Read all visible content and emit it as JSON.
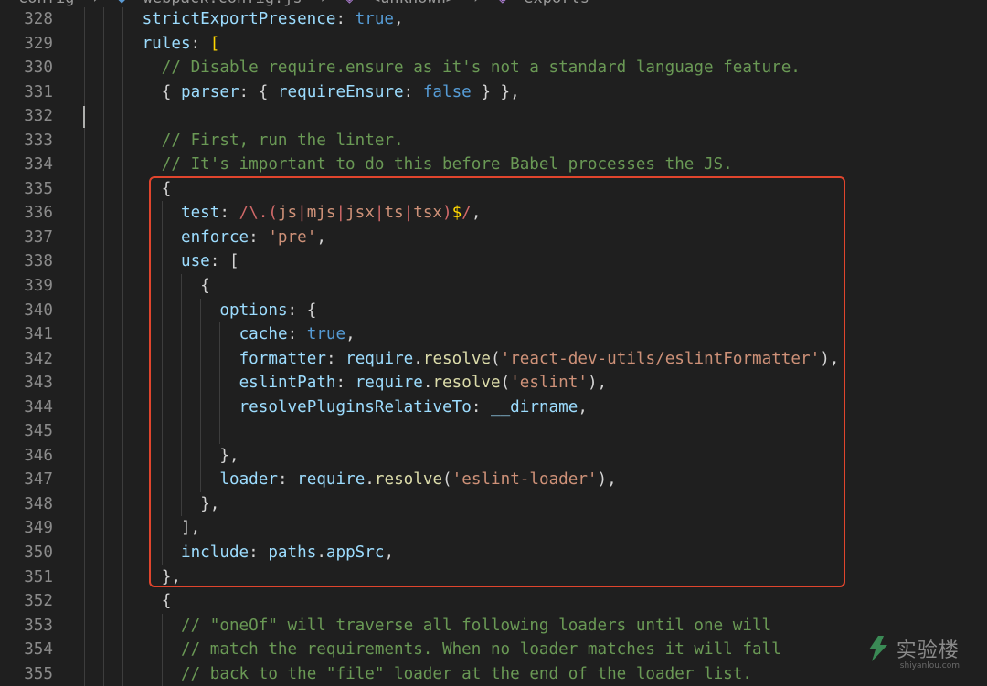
{
  "breadcrumb": {
    "items": [
      "config",
      "webpack.config.js",
      "<unknown>",
      "exports"
    ]
  },
  "editor": {
    "lines": [
      {
        "n": "328",
        "indent": 3,
        "tokens": [
          [
            "p",
            "strictExportPresence"
          ],
          [
            "w",
            ": "
          ],
          [
            "k",
            "true"
          ],
          [
            "w",
            ","
          ]
        ]
      },
      {
        "n": "329",
        "indent": 3,
        "tokens": [
          [
            "p",
            "rules"
          ],
          [
            "w",
            ": "
          ],
          [
            "y",
            "["
          ]
        ]
      },
      {
        "n": "330",
        "indent": 4,
        "tokens": [
          [
            "c",
            "// Disable require.ensure as it's not a standard language feature."
          ]
        ]
      },
      {
        "n": "331",
        "indent": 4,
        "tokens": [
          [
            "w",
            "{ "
          ],
          [
            "p",
            "parser"
          ],
          [
            "w",
            ": { "
          ],
          [
            "p",
            "requireEnsure"
          ],
          [
            "w",
            ": "
          ],
          [
            "k",
            "false"
          ],
          [
            "w",
            " } },"
          ]
        ]
      },
      {
        "n": "332",
        "indent": 0,
        "tokens": []
      },
      {
        "n": "333",
        "indent": 4,
        "tokens": [
          [
            "c",
            "// First, run the linter."
          ]
        ]
      },
      {
        "n": "334",
        "indent": 4,
        "tokens": [
          [
            "c",
            "// It's important to do this before Babel processes the JS."
          ]
        ]
      },
      {
        "n": "335",
        "indent": 4,
        "tokens": [
          [
            "w",
            "{"
          ]
        ]
      },
      {
        "n": "336",
        "indent": 5,
        "tokens": [
          [
            "p",
            "test"
          ],
          [
            "w",
            ": "
          ],
          [
            "r",
            "/\\.("
          ],
          [
            "s",
            "js"
          ],
          [
            "r",
            "|"
          ],
          [
            "s",
            "mjs"
          ],
          [
            "r",
            "|"
          ],
          [
            "s",
            "jsx"
          ],
          [
            "r",
            "|"
          ],
          [
            "s",
            "ts"
          ],
          [
            "r",
            "|"
          ],
          [
            "s",
            "tsx"
          ],
          [
            "r",
            ")"
          ],
          [
            "y",
            "$"
          ],
          [
            "r",
            "/"
          ],
          [
            "w",
            ","
          ]
        ]
      },
      {
        "n": "337",
        "indent": 5,
        "tokens": [
          [
            "p",
            "enforce"
          ],
          [
            "w",
            ": "
          ],
          [
            "s",
            "'pre'"
          ],
          [
            "w",
            ","
          ]
        ]
      },
      {
        "n": "338",
        "indent": 5,
        "tokens": [
          [
            "p",
            "use"
          ],
          [
            "w",
            ": ["
          ]
        ]
      },
      {
        "n": "339",
        "indent": 6,
        "tokens": [
          [
            "w",
            "{"
          ]
        ]
      },
      {
        "n": "340",
        "indent": 7,
        "tokens": [
          [
            "p",
            "options"
          ],
          [
            "w",
            ": {"
          ]
        ]
      },
      {
        "n": "341",
        "indent": 8,
        "tokens": [
          [
            "p",
            "cache"
          ],
          [
            "w",
            ": "
          ],
          [
            "k",
            "true"
          ],
          [
            "w",
            ","
          ]
        ]
      },
      {
        "n": "342",
        "indent": 8,
        "tokens": [
          [
            "p",
            "formatter"
          ],
          [
            "w",
            ": "
          ],
          [
            "p",
            "require"
          ],
          [
            "w",
            "."
          ],
          [
            "f",
            "resolve"
          ],
          [
            "w",
            "("
          ],
          [
            "s",
            "'react-dev-utils/eslintFormatter'"
          ],
          [
            "w",
            "),"
          ]
        ]
      },
      {
        "n": "343",
        "indent": 8,
        "tokens": [
          [
            "p",
            "eslintPath"
          ],
          [
            "w",
            ": "
          ],
          [
            "p",
            "require"
          ],
          [
            "w",
            "."
          ],
          [
            "f",
            "resolve"
          ],
          [
            "w",
            "("
          ],
          [
            "s",
            "'eslint'"
          ],
          [
            "w",
            "),"
          ]
        ]
      },
      {
        "n": "344",
        "indent": 8,
        "tokens": [
          [
            "p",
            "resolvePluginsRelativeTo"
          ],
          [
            "w",
            ": "
          ],
          [
            "p",
            "__dirname"
          ],
          [
            "w",
            ","
          ]
        ]
      },
      {
        "n": "345",
        "indent": 0,
        "tokens": []
      },
      {
        "n": "346",
        "indent": 7,
        "tokens": [
          [
            "w",
            "},"
          ]
        ]
      },
      {
        "n": "347",
        "indent": 7,
        "tokens": [
          [
            "p",
            "loader"
          ],
          [
            "w",
            ": "
          ],
          [
            "p",
            "require"
          ],
          [
            "w",
            "."
          ],
          [
            "f",
            "resolve"
          ],
          [
            "w",
            "("
          ],
          [
            "s",
            "'eslint-loader'"
          ],
          [
            "w",
            "),"
          ]
        ]
      },
      {
        "n": "348",
        "indent": 6,
        "tokens": [
          [
            "w",
            "},"
          ]
        ]
      },
      {
        "n": "349",
        "indent": 5,
        "tokens": [
          [
            "w",
            "],"
          ]
        ]
      },
      {
        "n": "350",
        "indent": 5,
        "tokens": [
          [
            "p",
            "include"
          ],
          [
            "w",
            ": "
          ],
          [
            "p",
            "paths"
          ],
          [
            "w",
            "."
          ],
          [
            "p",
            "appSrc"
          ],
          [
            "w",
            ","
          ]
        ]
      },
      {
        "n": "351",
        "indent": 4,
        "tokens": [
          [
            "w",
            "},"
          ]
        ]
      },
      {
        "n": "352",
        "indent": 4,
        "tokens": [
          [
            "w",
            "{"
          ]
        ]
      },
      {
        "n": "353",
        "indent": 5,
        "tokens": [
          [
            "c",
            "// \"oneOf\" will traverse all following loaders until one will"
          ]
        ]
      },
      {
        "n": "354",
        "indent": 5,
        "tokens": [
          [
            "c",
            "// match the requirements. When no loader matches it will fall"
          ]
        ]
      },
      {
        "n": "355",
        "indent": 5,
        "tokens": [
          [
            "c",
            "// back to the \"file\" loader at the end of the loader list."
          ]
        ]
      }
    ]
  },
  "watermark": {
    "brand": "实验楼",
    "url": "shiyanlou.com"
  },
  "colors": {
    "background": "#1f1f1f",
    "highlight_border": "#e0452d"
  }
}
